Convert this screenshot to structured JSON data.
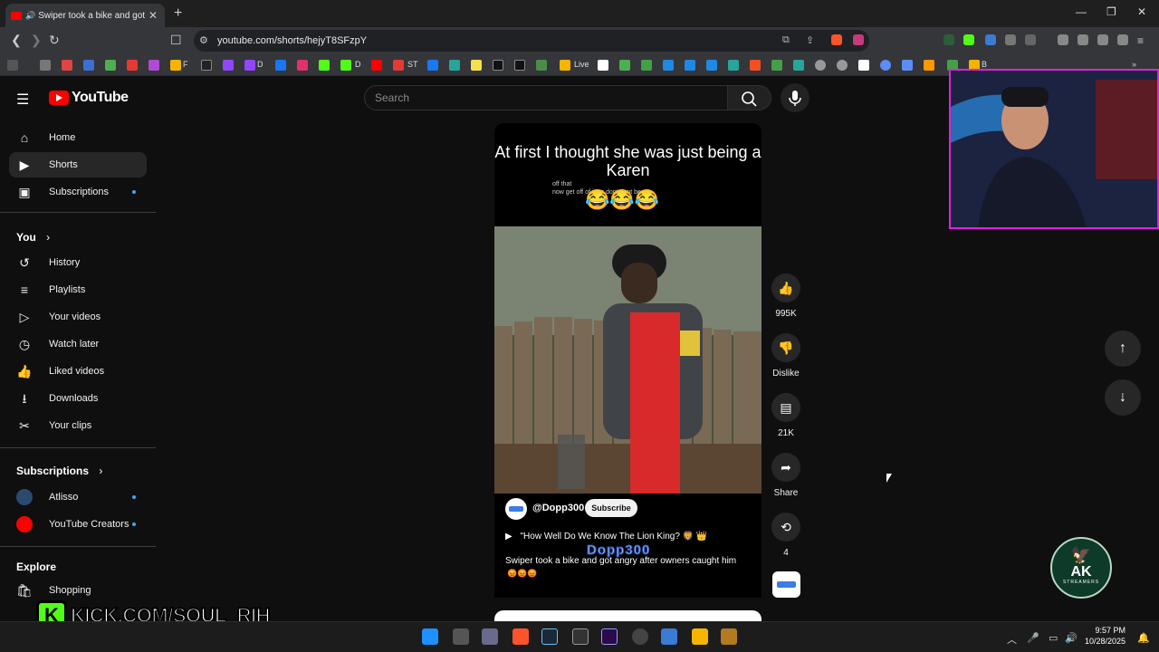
{
  "browser": {
    "tab_title": "Swiper took a bike and got ar",
    "url": "youtube.com/shorts/hejyT8SFzpY",
    "bookmarks": [
      "F",
      "D",
      "D",
      "ST",
      "Live",
      "B"
    ]
  },
  "youtube": {
    "logo_text": "YouTube",
    "search_placeholder": "Search",
    "sidebar": {
      "main": [
        {
          "label": "Home",
          "icon": "home-icon"
        },
        {
          "label": "Shorts",
          "icon": "shorts-icon",
          "active": true
        },
        {
          "label": "Subscriptions",
          "icon": "subscriptions-icon"
        }
      ],
      "you_heading": "You",
      "you_items": [
        {
          "label": "History",
          "icon": "history-icon"
        },
        {
          "label": "Playlists",
          "icon": "playlists-icon"
        },
        {
          "label": "Your videos",
          "icon": "your-videos-icon"
        },
        {
          "label": "Watch later",
          "icon": "watch-later-icon"
        },
        {
          "label": "Liked videos",
          "icon": "liked-videos-icon"
        },
        {
          "label": "Downloads",
          "icon": "downloads-icon"
        },
        {
          "label": "Your clips",
          "icon": "clips-icon"
        }
      ],
      "subscriptions_heading": "Subscriptions",
      "subscriptions": [
        {
          "label": "Atlisso"
        },
        {
          "label": "YouTube Creators"
        }
      ],
      "explore_heading": "Explore",
      "explore_items": [
        {
          "label": "Shopping",
          "icon": "shopping-icon"
        }
      ]
    },
    "short": {
      "caption": "At first I thought she was just being a Karen",
      "subcaption_line1": "off that",
      "subcaption_line2": "now get off of it no dont dont be a",
      "caption_emojis": "😂😂😂",
      "channel": "@Dopp300",
      "subscribe_label": "Subscribe",
      "playlist": "\"How Well Do We Know The Lion King? 🦁 👑",
      "watermark": "Dopp300",
      "description": "Swiper took a bike and got angry after owners caught him",
      "description_emojis": "😡😡😡"
    },
    "actions": {
      "like_count": "995K",
      "dislike_label": "Dislike",
      "comment_count": "21K",
      "share_label": "Share",
      "remix_count": "4"
    }
  },
  "overlay": {
    "kick_text": "KICK.COM/SOUL_RIH",
    "kick_k": "K",
    "ak_logo_text": "AK",
    "ak_logo_sub": "STREAMERS"
  },
  "taskbar": {
    "time": "9:57 PM",
    "date": "10/28/2025"
  },
  "colors": {
    "youtube_red": "#ff0000",
    "kick_green": "#53fc18",
    "webcam_border": "#e020e0",
    "sub_dot": "#3ea6ff"
  }
}
